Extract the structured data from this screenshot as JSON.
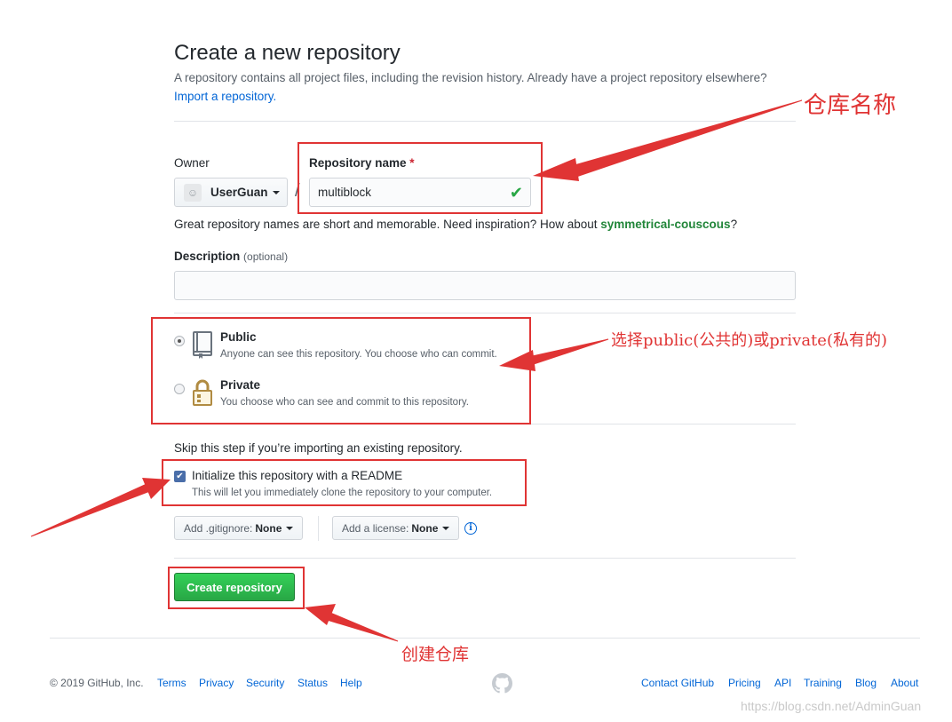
{
  "header": {
    "title": "Create a new repository",
    "subtitle": "A repository contains all project files, including the revision history. Already have a project repository elsewhere?",
    "import_link": "Import a repository."
  },
  "owner": {
    "label": "Owner",
    "value": "UserGuan"
  },
  "repo_name": {
    "label": "Repository name",
    "required_mark": "*",
    "value": "multiblock",
    "valid": true
  },
  "hint": {
    "text": "Great repository names are short and memorable. Need inspiration? How about ",
    "suggestion": "symmetrical-couscous",
    "end": "?"
  },
  "description": {
    "label": "Description",
    "optional": "(optional)",
    "value": ""
  },
  "visibility": {
    "public": {
      "title": "Public",
      "note": "Anyone can see this repository. You choose who can commit.",
      "selected": true
    },
    "private": {
      "title": "Private",
      "note": "You choose who can see and commit to this repository.",
      "selected": false
    }
  },
  "init": {
    "skip_text": "Skip this step if you’re importing an existing repository.",
    "readme_label": "Initialize this repository with a README",
    "readme_note": "This will let you immediately clone the repository to your computer.",
    "readme_checked": true,
    "gitignore_label": "Add .gitignore:",
    "gitignore_value": "None",
    "license_label": "Add a license:",
    "license_value": "None"
  },
  "create_button": "Create repository",
  "footer": {
    "copyright": "© 2019 GitHub, Inc.",
    "left_links": [
      "Terms",
      "Privacy",
      "Security",
      "Status",
      "Help"
    ],
    "right_links": [
      "Contact GitHub",
      "Pricing",
      "API",
      "Training",
      "Blog",
      "About"
    ]
  },
  "watermark": "https://blog.csdn.net/AdminGuan",
  "annotations": {
    "repo_name": "仓库名称",
    "visibility": "选择public(公共的)或private(私有的)",
    "create": "创建仓库"
  },
  "colors": {
    "annotation_red": "#e03434",
    "create_green": "#28a745",
    "link_blue": "#0366d6",
    "suggestion_green": "#22863a"
  }
}
